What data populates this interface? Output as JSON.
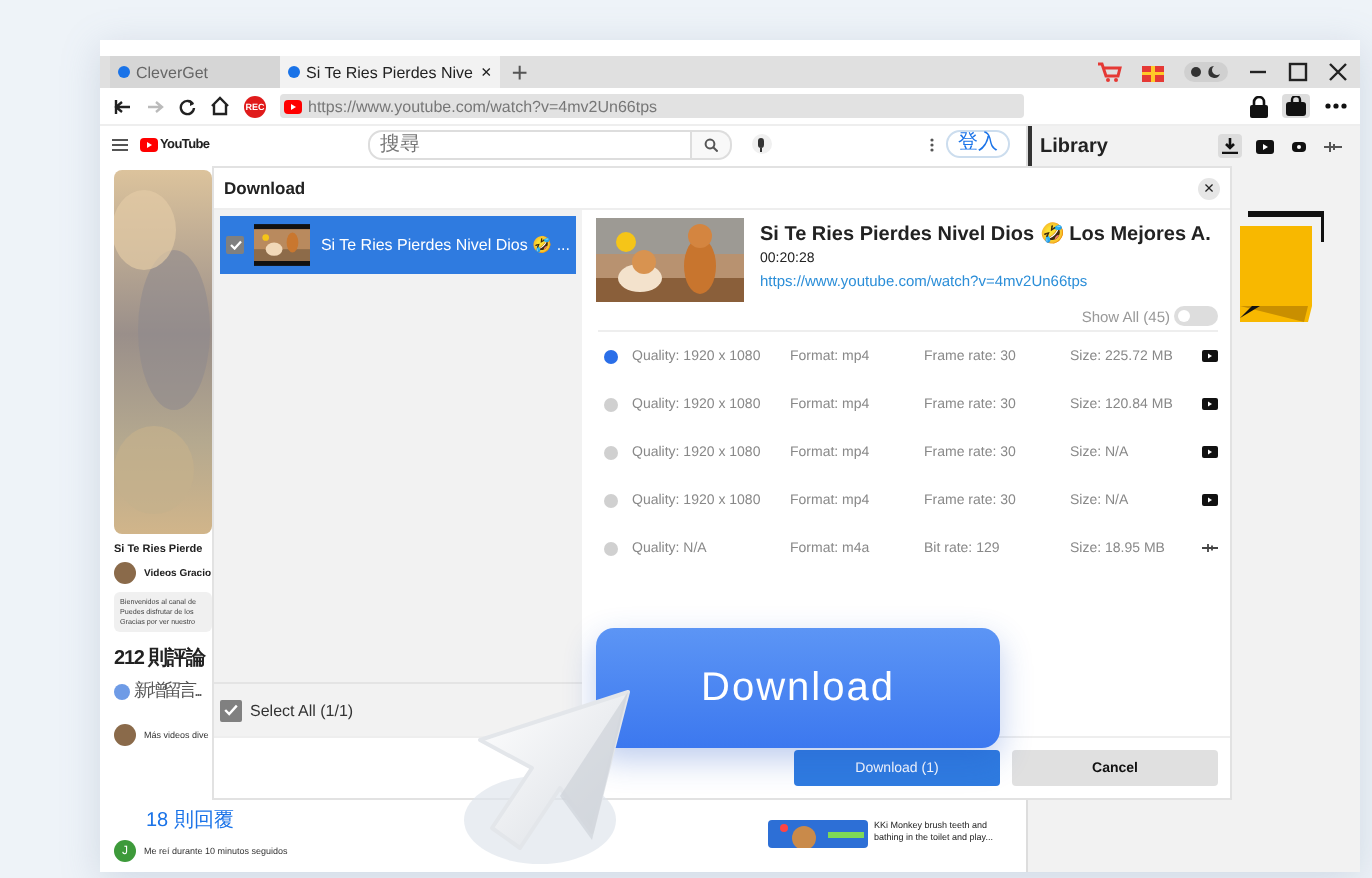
{
  "browser": {
    "tabs": [
      {
        "label": "CleverGet",
        "selected": false
      },
      {
        "label": "Si Te Ries Pierdes Nive",
        "selected": true
      }
    ],
    "tab_close": "×",
    "new_tab": "+",
    "rec_badge": "REC",
    "url": "https://www.youtube.com/watch?v=4mv2Un66tps"
  },
  "youtube": {
    "logo": "YouTube",
    "search": {
      "placeholder": "搜尋"
    },
    "login": "登入",
    "video_title": "Si Te Ries Pierde",
    "channel": "Videos Gracio",
    "description": [
      "Bienvenidos al canal de",
      "Puedes disfrutar de los",
      "Gracias por ver nuestro"
    ],
    "comments_count": "212 則評論",
    "comment_placeholder": "新增留言...",
    "comment_text": "Más videos dive",
    "replies": "18 則回覆",
    "reply_avatar": "J",
    "reply_text": "Me reí durante 10 minutos seguidos",
    "related": [
      {
        "title": "KKi Monkey brush teeth and bathing in the toilet and play..."
      }
    ]
  },
  "library": {
    "title": "Library",
    "tabs": [
      {
        "kind": "download",
        "selected": true
      },
      {
        "kind": "video",
        "selected": false
      },
      {
        "kind": "music",
        "selected": false
      },
      {
        "kind": "audio",
        "selected": false
      }
    ]
  },
  "dialog": {
    "title": "Download",
    "close": "×",
    "items": [
      {
        "title": "Si Te Ries Pierdes Nivel Dios 🤣 ...",
        "checked": true,
        "selected": true
      }
    ],
    "select_all": {
      "label": "Select All (1/1)",
      "checked": true
    },
    "video": {
      "title": "Si Te Ries Pierdes Nivel Dios 🤣 Los Mejores A.",
      "duration": "00:20:28",
      "url": "https://www.youtube.com/watch?v=4mv2Un66tps"
    },
    "show_all": {
      "label": "Show All (45)",
      "on": false
    },
    "options": [
      {
        "kind": "video",
        "selected": true,
        "quality": "Quality: 1920 x 1080",
        "format": "Format: mp4",
        "rate": "Frame rate: 30",
        "size": "Size: 225.72 MB"
      },
      {
        "kind": "video",
        "selected": false,
        "quality": "Quality: 1920 x 1080",
        "format": "Format: mp4",
        "rate": "Frame rate: 30",
        "size": "Size: 120.84 MB"
      },
      {
        "kind": "video",
        "selected": false,
        "quality": "Quality: 1920 x 1080",
        "format": "Format: mp4",
        "rate": "Frame rate: 30",
        "size": "Size: N/A"
      },
      {
        "kind": "video",
        "selected": false,
        "quality": "Quality: 1920 x 1080",
        "format": "Format: mp4",
        "rate": "Frame rate: 30",
        "size": "Size: N/A"
      },
      {
        "kind": "audio",
        "selected": false,
        "quality": "Quality: N/A",
        "format": "Format: m4a",
        "rate": "Bit rate: 129",
        "size": "Size: 18.95 MB"
      }
    ],
    "buttons": {
      "download": "Download (1)",
      "cancel": "Cancel"
    }
  },
  "promo": {
    "button": "Download"
  }
}
